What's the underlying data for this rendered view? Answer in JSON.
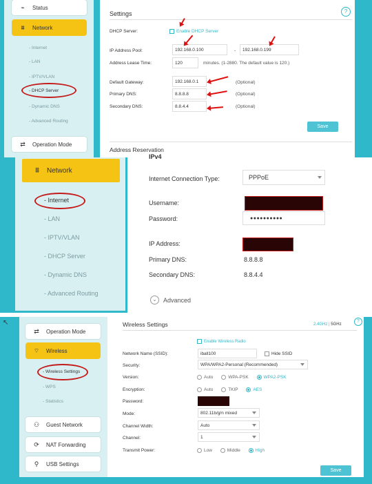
{
  "panel1": {
    "sidebar": {
      "status": "Status",
      "network": "Network",
      "sub_items": [
        "Internet",
        "LAN",
        "IPTV/VLAN",
        "DHCP Server",
        "Dynamic DNS",
        "Advanced Routing"
      ],
      "operation_mode": "Operation Mode"
    },
    "settings_title": "Settings",
    "help_icon": "?",
    "dhcp_server_label": "DHCP Server:",
    "enable_dhcp": "Enable DHCP Server",
    "ip_pool_label": "IP Address Pool:",
    "ip_pool_start": "192.168.0.100",
    "ip_pool_dash": "-",
    "ip_pool_end": "192.168.0.199",
    "lease_label": "Address Lease Time:",
    "lease_value": "120",
    "lease_hint": "minutes. (1-2880. The default value is 120.)",
    "gateway_label": "Default Gateway:",
    "gateway_value": "192.168.0.1",
    "primary_dns_label": "Primary DNS:",
    "primary_dns_value": "8.8.8.8",
    "secondary_dns_label": "Secondary DNS:",
    "secondary_dns_value": "8.8.4.4",
    "optional": "(Optional)",
    "save": "Save",
    "address_reservation": "Address Reservation"
  },
  "panel2": {
    "sidebar": {
      "network": "Network",
      "sub_items": [
        "Internet",
        "LAN",
        "IPTV/VLAN",
        "DHCP Server",
        "Dynamic DNS",
        "Advanced Routing"
      ]
    },
    "section_title": "IPv4",
    "conn_type_label": "Internet Connection Type:",
    "conn_type_value": "PPPoE",
    "username_label": "Username:",
    "password_label": "Password:",
    "password_value": "●●●●●●●●●●",
    "ip_label": "IP Address:",
    "primary_dns_label": "Primary DNS:",
    "primary_dns_value": "8.8.8.8",
    "secondary_dns_label": "Secondary DNS:",
    "secondary_dns_value": "8.8.4.4",
    "advanced": "Advanced"
  },
  "panel3": {
    "sidebar": {
      "operation_mode": "Operation Mode",
      "wireless": "Wireless",
      "sub_items": [
        "Wireless Settings",
        "WPS",
        "Statistics"
      ],
      "guest_network": "Guest Network",
      "nat_forwarding": "NAT Forwarding",
      "usb_settings": "USB Settings"
    },
    "title": "Wireless Settings",
    "band_24": "2.4GHz",
    "band_sep": "|",
    "band_5": "5GHz",
    "help_icon": "?",
    "enable_radio": "Enable Wireless Radio",
    "ssid_label": "Network Name (SSID):",
    "ssid_value": "iball100",
    "hide_ssid": "Hide SSID",
    "security_label": "Security:",
    "security_value": "WPA/WPA2-Personal (Recommended)",
    "version_label": "Version:",
    "version_options": [
      "Auto",
      "WPA-PSK",
      "WPA2-PSK"
    ],
    "encryption_label": "Encryption:",
    "encryption_options": [
      "Auto",
      "TKIP",
      "AES"
    ],
    "password_label": "Password:",
    "mode_label": "Mode:",
    "mode_value": "802.11b/g/n mixed",
    "channel_width_label": "Channel Width:",
    "channel_width_value": "Auto",
    "channel_label": "Channel:",
    "channel_value": "1",
    "tx_power_label": "Transmit Power:",
    "tx_power_options": [
      "Low",
      "Middle",
      "High"
    ],
    "save": "Save"
  },
  "colors": {
    "teal": "#2fb8c9",
    "sidebar_bg": "#d9f0f2",
    "active_yellow": "#f5c313",
    "annotation_red": "#c41a1a",
    "redacted": "#2a0505"
  }
}
